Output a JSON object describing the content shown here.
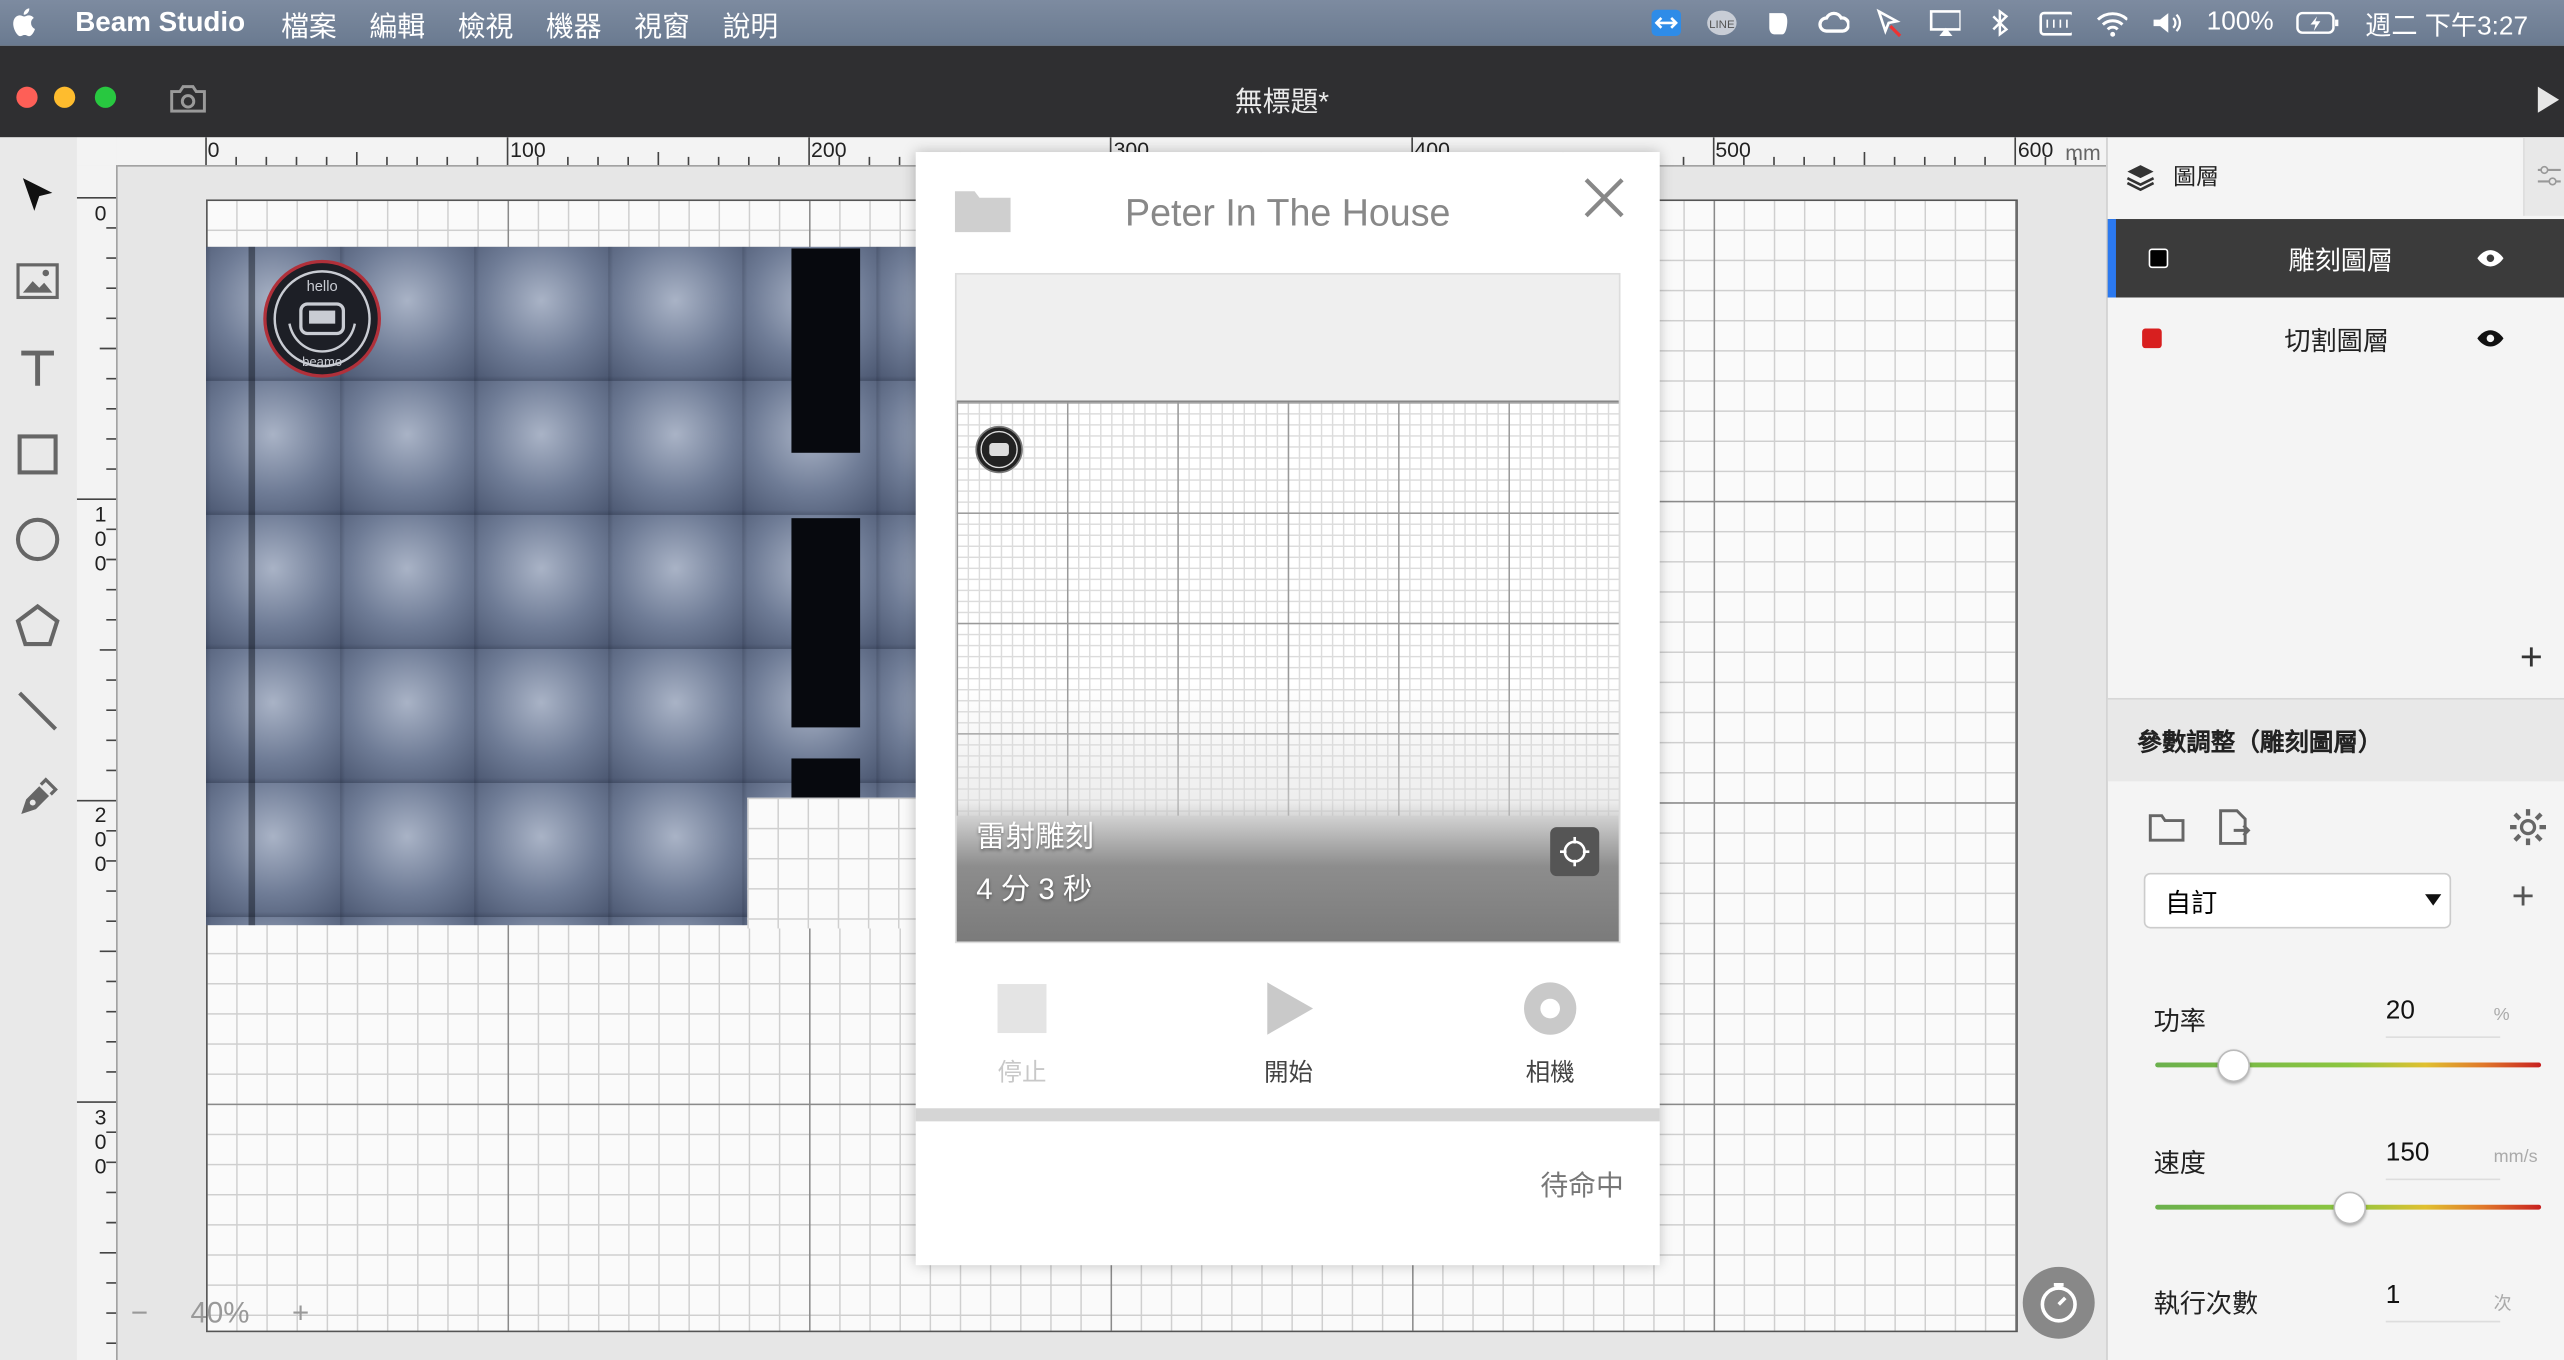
{
  "menubar": {
    "app_name": "Beam Studio",
    "items": [
      "檔案",
      "編輯",
      "檢視",
      "機器",
      "視窗",
      "說明"
    ],
    "battery": "100%",
    "clock": "週二 下午3:27",
    "status_icons": [
      "teamviewer-icon",
      "line-icon",
      "evernote-icon",
      "creative-cloud-icon",
      "cursor-icon",
      "airplay-icon",
      "bluetooth-icon",
      "keyboard-icon",
      "wifi-icon",
      "volume-icon",
      "battery-icon"
    ]
  },
  "window": {
    "title": "無標題*"
  },
  "toolbar": {
    "tools": [
      "select-tool",
      "image-tool",
      "text-tool",
      "rectangle-tool",
      "ellipse-tool",
      "polygon-tool",
      "line-tool",
      "pen-tool"
    ]
  },
  "rulers": {
    "h_labels": [
      "0",
      "100",
      "200",
      "300",
      "400",
      "500",
      "600"
    ],
    "unit": "mm",
    "v_labels": [
      "0",
      "100",
      "200",
      "300"
    ]
  },
  "canvas": {
    "zoom": "40%",
    "zoom_out": "−",
    "zoom_in": "+"
  },
  "layers_panel": {
    "title": "圖層",
    "layers": [
      {
        "name": "雕刻圖層",
        "color": "#000000",
        "active": true
      },
      {
        "name": "切割圖層",
        "color": "#d81f1f",
        "active": false
      }
    ],
    "add": "+"
  },
  "params": {
    "title": "參數調整（雕刻圖層）",
    "preset": "自訂",
    "add": "+",
    "power": {
      "label": "功率",
      "value": "20",
      "unit": "%",
      "fraction": 0.2
    },
    "speed": {
      "label": "速度",
      "value": "150",
      "unit": "mm/s",
      "fraction": 0.5
    },
    "repeat": {
      "label": "執行次數",
      "value": "1",
      "unit": "次"
    }
  },
  "monitor": {
    "device_name": "Peter In The House",
    "task_name": "雷射雕刻",
    "task_time": "4 分 3 秒",
    "stop_label": "停止",
    "start_label": "開始",
    "camera_label": "相機",
    "status": "待命中"
  },
  "logo_text": {
    "top": "hello",
    "bottom": "beamo"
  }
}
